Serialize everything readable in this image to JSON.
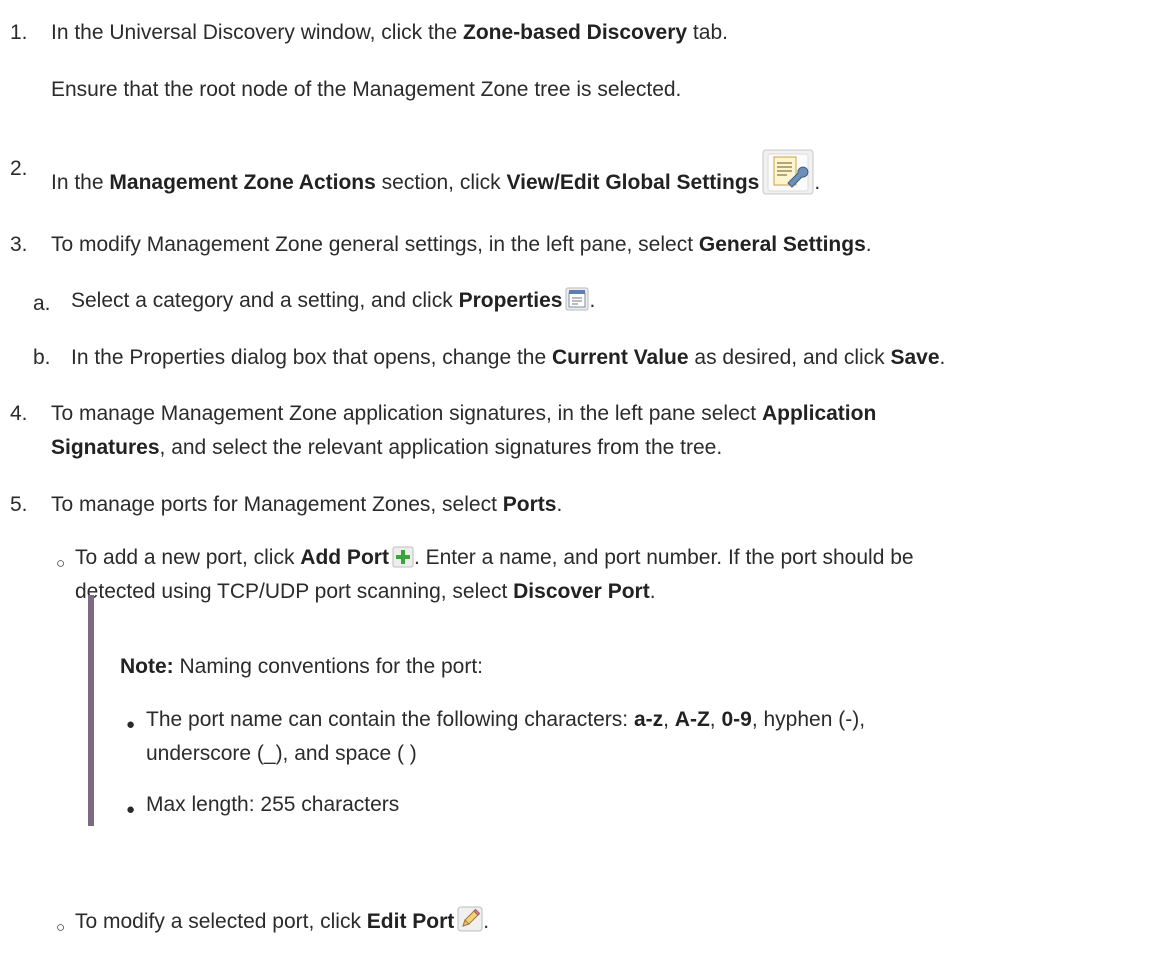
{
  "steps": {
    "s1": {
      "num": "1.",
      "pre": "In the Universal Discovery window, click the ",
      "b1": "Zone-based Discovery",
      "post": " tab."
    },
    "s1_sub": "Ensure that the root node of the Management Zone tree is selected.",
    "s2": {
      "num": "2.",
      "pre": "In the ",
      "b1": "Management Zone Actions",
      "mid": " section, click ",
      "b2": "View/Edit Global Settings",
      "post": "."
    },
    "s3": {
      "num": "3.",
      "pre": "To modify Management Zone general settings, in the left pane, select ",
      "b1": "General Settings",
      "post": "."
    },
    "s3a": {
      "num": "a.",
      "pre": "Select a category and a setting, and click ",
      "b1": "Properties",
      "post": "."
    },
    "s3b": {
      "num": "b.",
      "pre": "In the Properties dialog box that opens, change the ",
      "b1": "Current Value",
      "mid": " as desired, and click ",
      "b2": "Save",
      "post": "."
    },
    "s4": {
      "num": "4.",
      "pre": "To manage Management Zone application signatures, in the left pane select ",
      "b1": "Application",
      "b1b": "Signatures",
      "post": ", and select the relevant application signatures from the tree."
    },
    "s5": {
      "num": "5.",
      "pre": "To manage ports for Management Zones, select ",
      "b1": "Ports",
      "post": "."
    },
    "s5a": {
      "pre": "To add a new port, click ",
      "b1": "Add Port",
      "post": ". Enter a name, and port number. If the port should be",
      "line2pre": "detected using TCP/UDP port scanning, select ",
      "b2": "Discover Port",
      "line2post": "."
    },
    "note": {
      "label": "Note:",
      "text": " Naming conventions for the port:",
      "b1": {
        "pre": "The port name can contain the following characters: ",
        "k1": "a-z",
        "c1": ", ",
        "k2": "A-Z",
        "c2": ", ",
        "k3": "0-9",
        "post": ", hyphen (-),",
        "line2": "underscore (_), and space ( )"
      },
      "b2": "Max length: 255 characters"
    },
    "s5b": {
      "pre": "To modify a selected port, click ",
      "b1": "Edit Port",
      "post": "."
    }
  },
  "icons": [
    "global-settings-icon",
    "properties-icon",
    "add-port-icon",
    "edit-port-icon"
  ],
  "colors": {
    "text": "#2b2b2b",
    "note_bar": "#7a6b82",
    "add_icon": "#3aa53a"
  }
}
